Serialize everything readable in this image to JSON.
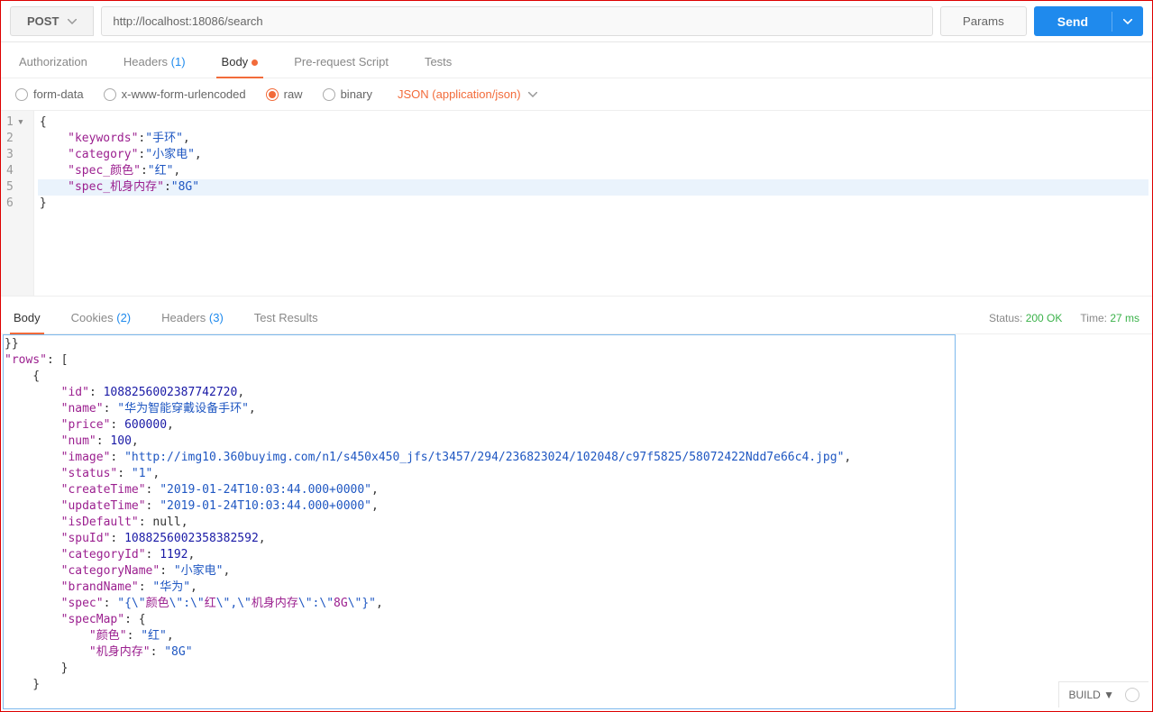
{
  "request": {
    "method": "POST",
    "url": "http://localhost:18086/search",
    "params_label": "Params",
    "send_label": "Send"
  },
  "tabs": {
    "auth": "Authorization",
    "headers_label": "Headers",
    "headers_count": "(1)",
    "body": "Body",
    "prerequest": "Pre-request Script",
    "tests": "Tests"
  },
  "body_options": {
    "formdata": "form-data",
    "urlencoded": "x-www-form-urlencoded",
    "raw": "raw",
    "binary": "binary",
    "content_type": "JSON (application/json)"
  },
  "editor": {
    "lines": [
      {
        "n": "1",
        "fold": "▾",
        "tokens": [
          {
            "t": "{",
            "c": "tok-p"
          }
        ]
      },
      {
        "n": "2",
        "tokens": [
          {
            "t": "    ",
            "c": ""
          },
          {
            "t": "\"keywords\"",
            "c": "tok-k"
          },
          {
            "t": ":",
            "c": "tok-p"
          },
          {
            "t": "\"手环\"",
            "c": "tok-s"
          },
          {
            "t": ",",
            "c": "tok-p"
          }
        ]
      },
      {
        "n": "3",
        "tokens": [
          {
            "t": "    ",
            "c": ""
          },
          {
            "t": "\"category\"",
            "c": "tok-k"
          },
          {
            "t": ":",
            "c": "tok-p"
          },
          {
            "t": "\"小家电\"",
            "c": "tok-s"
          },
          {
            "t": ",",
            "c": "tok-p"
          }
        ]
      },
      {
        "n": "4",
        "tokens": [
          {
            "t": "    ",
            "c": ""
          },
          {
            "t": "\"spec_颜色\"",
            "c": "tok-k"
          },
          {
            "t": ":",
            "c": "tok-p"
          },
          {
            "t": "\"红\"",
            "c": "tok-s"
          },
          {
            "t": ",",
            "c": "tok-p"
          }
        ]
      },
      {
        "n": "5",
        "hl": true,
        "tokens": [
          {
            "t": "    ",
            "c": ""
          },
          {
            "t": "\"spec_机身内存\"",
            "c": "tok-k"
          },
          {
            "t": ":",
            "c": "tok-p"
          },
          {
            "t": "\"8G\"",
            "c": "tok-s"
          }
        ]
      },
      {
        "n": "6",
        "tokens": [
          {
            "t": "}",
            "c": "tok-p"
          }
        ]
      }
    ]
  },
  "resp_tabs": {
    "body": "Body",
    "cookies_label": "Cookies",
    "cookies_count": "(2)",
    "headers_label": "Headers",
    "headers_count": "(3)",
    "tests": "Test Results"
  },
  "status": {
    "status_label": "Status:",
    "status_value": "200 OK",
    "time_label": "Time:",
    "time_value": "27 ms"
  },
  "response_lines": [
    [
      {
        "t": "}}",
        "c": "tok-p"
      }
    ],
    [
      {
        "t": "\"rows\"",
        "c": "tok-k"
      },
      {
        "t": ": [",
        "c": "tok-p"
      }
    ],
    [
      {
        "t": "    {",
        "c": "tok-p"
      }
    ],
    [
      {
        "t": "        ",
        "c": ""
      },
      {
        "t": "\"id\"",
        "c": "tok-k"
      },
      {
        "t": ": ",
        "c": "tok-p"
      },
      {
        "t": "1088256002387742720",
        "c": "tok-n"
      },
      {
        "t": ",",
        "c": "tok-p"
      }
    ],
    [
      {
        "t": "        ",
        "c": ""
      },
      {
        "t": "\"name\"",
        "c": "tok-k"
      },
      {
        "t": ": ",
        "c": "tok-p"
      },
      {
        "t": "\"华为智能穿戴设备手环\"",
        "c": "tok-s"
      },
      {
        "t": ",",
        "c": "tok-p"
      }
    ],
    [
      {
        "t": "        ",
        "c": ""
      },
      {
        "t": "\"price\"",
        "c": "tok-k"
      },
      {
        "t": ": ",
        "c": "tok-p"
      },
      {
        "t": "600000",
        "c": "tok-n"
      },
      {
        "t": ",",
        "c": "tok-p"
      }
    ],
    [
      {
        "t": "        ",
        "c": ""
      },
      {
        "t": "\"num\"",
        "c": "tok-k"
      },
      {
        "t": ": ",
        "c": "tok-p"
      },
      {
        "t": "100",
        "c": "tok-n"
      },
      {
        "t": ",",
        "c": "tok-p"
      }
    ],
    [
      {
        "t": "        ",
        "c": ""
      },
      {
        "t": "\"image\"",
        "c": "tok-k"
      },
      {
        "t": ": ",
        "c": "tok-p"
      },
      {
        "t": "\"http://img10.360buyimg.com/n1/s450x450_jfs/t3457/294/236823024/102048/c97f5825/58072422Ndd7e66c4.jpg\"",
        "c": "tok-s"
      },
      {
        "t": ",",
        "c": "tok-p"
      }
    ],
    [
      {
        "t": "        ",
        "c": ""
      },
      {
        "t": "\"status\"",
        "c": "tok-k"
      },
      {
        "t": ": ",
        "c": "tok-p"
      },
      {
        "t": "\"1\"",
        "c": "tok-s"
      },
      {
        "t": ",",
        "c": "tok-p"
      }
    ],
    [
      {
        "t": "        ",
        "c": ""
      },
      {
        "t": "\"createTime\"",
        "c": "tok-k"
      },
      {
        "t": ": ",
        "c": "tok-p"
      },
      {
        "t": "\"2019-01-24T10:03:44.000+0000\"",
        "c": "tok-s"
      },
      {
        "t": ",",
        "c": "tok-p"
      }
    ],
    [
      {
        "t": "        ",
        "c": ""
      },
      {
        "t": "\"updateTime\"",
        "c": "tok-k"
      },
      {
        "t": ": ",
        "c": "tok-p"
      },
      {
        "t": "\"2019-01-24T10:03:44.000+0000\"",
        "c": "tok-s"
      },
      {
        "t": ",",
        "c": "tok-p"
      }
    ],
    [
      {
        "t": "        ",
        "c": ""
      },
      {
        "t": "\"isDefault\"",
        "c": "tok-k"
      },
      {
        "t": ": ",
        "c": "tok-p"
      },
      {
        "t": "null",
        "c": "tok-null"
      },
      {
        "t": ",",
        "c": "tok-p"
      }
    ],
    [
      {
        "t": "        ",
        "c": ""
      },
      {
        "t": "\"spuId\"",
        "c": "tok-k"
      },
      {
        "t": ": ",
        "c": "tok-p"
      },
      {
        "t": "1088256002358382592",
        "c": "tok-n"
      },
      {
        "t": ",",
        "c": "tok-p"
      }
    ],
    [
      {
        "t": "        ",
        "c": ""
      },
      {
        "t": "\"categoryId\"",
        "c": "tok-k"
      },
      {
        "t": ": ",
        "c": "tok-p"
      },
      {
        "t": "1192",
        "c": "tok-n"
      },
      {
        "t": ",",
        "c": "tok-p"
      }
    ],
    [
      {
        "t": "        ",
        "c": ""
      },
      {
        "t": "\"categoryName\"",
        "c": "tok-k"
      },
      {
        "t": ": ",
        "c": "tok-p"
      },
      {
        "t": "\"小家电\"",
        "c": "tok-s"
      },
      {
        "t": ",",
        "c": "tok-p"
      }
    ],
    [
      {
        "t": "        ",
        "c": ""
      },
      {
        "t": "\"brandName\"",
        "c": "tok-k"
      },
      {
        "t": ": ",
        "c": "tok-p"
      },
      {
        "t": "\"华为\"",
        "c": "tok-s"
      },
      {
        "t": ",",
        "c": "tok-p"
      }
    ],
    [
      {
        "t": "        ",
        "c": ""
      },
      {
        "t": "\"spec\"",
        "c": "tok-k"
      },
      {
        "t": ": ",
        "c": "tok-p"
      },
      {
        "t": "\"{\\\"",
        "c": "tok-s"
      },
      {
        "t": "颜色",
        "c": "tok-k"
      },
      {
        "t": "\\\":\\\"",
        "c": "tok-s"
      },
      {
        "t": "红",
        "c": "tok-k"
      },
      {
        "t": "\\\",\\\"",
        "c": "tok-s"
      },
      {
        "t": "机身内存",
        "c": "tok-k"
      },
      {
        "t": "\\\":\\\"",
        "c": "tok-s"
      },
      {
        "t": "8G",
        "c": "tok-k"
      },
      {
        "t": "\\\"}\"",
        "c": "tok-s"
      },
      {
        "t": ",",
        "c": "tok-p"
      }
    ],
    [
      {
        "t": "        ",
        "c": ""
      },
      {
        "t": "\"specMap\"",
        "c": "tok-k"
      },
      {
        "t": ": {",
        "c": "tok-p"
      }
    ],
    [
      {
        "t": "            ",
        "c": ""
      },
      {
        "t": "\"颜色\"",
        "c": "tok-k"
      },
      {
        "t": ": ",
        "c": "tok-p"
      },
      {
        "t": "\"红\"",
        "c": "tok-s"
      },
      {
        "t": ",",
        "c": "tok-p"
      }
    ],
    [
      {
        "t": "            ",
        "c": ""
      },
      {
        "t": "\"机身内存\"",
        "c": "tok-k"
      },
      {
        "t": ": ",
        "c": "tok-p"
      },
      {
        "t": "\"8G\"",
        "c": "tok-s"
      }
    ],
    [
      {
        "t": "        }",
        "c": "tok-p"
      }
    ],
    [
      {
        "t": "    }",
        "c": "tok-p"
      }
    ]
  ],
  "footer": {
    "build": "BUILD"
  }
}
